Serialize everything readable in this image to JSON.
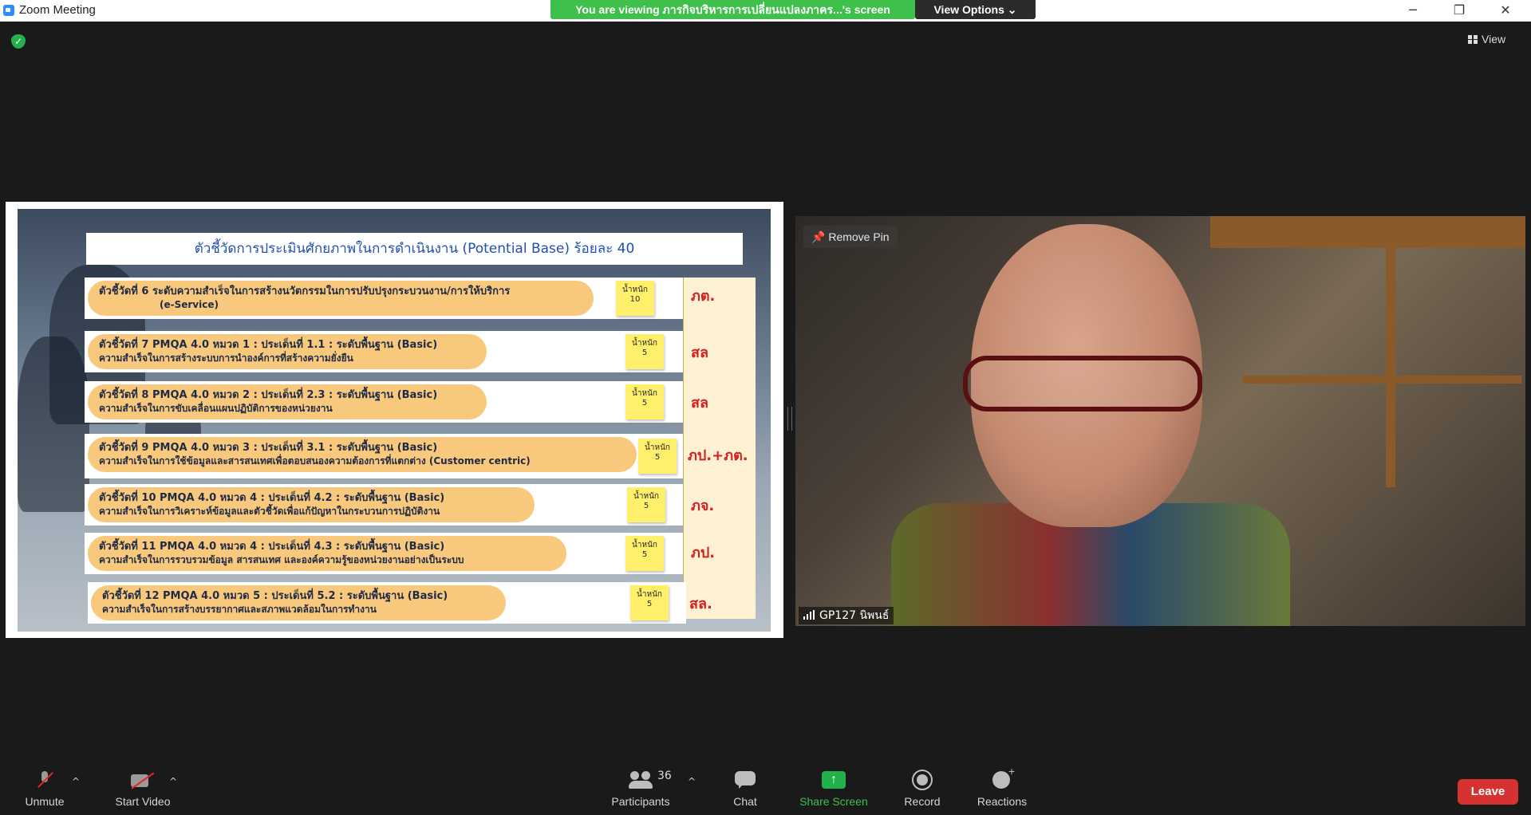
{
  "window": {
    "title": "Zoom Meeting",
    "share_banner": "You are viewing ภารกิจบริหารการเปลี่ยนแปลงภาคร...'s screen",
    "view_options": "View Options",
    "view_label": "View"
  },
  "slide": {
    "title": "ตัวชี้วัดการประเมินศักยภาพในการดำเนินงาน (Potential Base) ร้อยละ 40",
    "indicators": [
      {
        "line1": "ตัวชี้วัดที่ 6 ระดับความสำเร็จในการสร้างนวัตกรรมในการปรับปรุงกระบวนงาน/การให้บริการ",
        "line2": "(e-Service)",
        "weight_label": "น้ำหนัก",
        "weight": "10",
        "unit": "ภต."
      },
      {
        "line1": "ตัวชี้วัดที่ 7 PMQA 4.0 หมวด 1 : ประเด็นที่ 1.1 : ระดับพื้นฐาน (Basic)",
        "line2": "ความสำเร็จในการสร้างระบบการนำองค์การที่สร้างความยั่งยืน",
        "weight_label": "น้ำหนัก",
        "weight": "5",
        "unit": "สล"
      },
      {
        "line1": "ตัวชี้วัดที่ 8 PMQA 4.0 หมวด 2 : ประเด็นที่ 2.3 : ระดับพื้นฐาน (Basic)",
        "line2": "ความสำเร็จในการขับเคลื่อนแผนปฏิบัติการของหน่วยงาน",
        "weight_label": "น้ำหนัก",
        "weight": "5",
        "unit": "สล"
      },
      {
        "line1": "ตัวชี้วัดที่ 9 PMQA 4.0 หมวด 3 : ประเด็นที่ 3.1 : ระดับพื้นฐาน (Basic)",
        "line2": "ความสำเร็จในการใช้ข้อมูลและสารสนเทศเพื่อตอบสนองความต้องการที่แตกต่าง (Customer centric)",
        "weight_label": "น้ำหนัก",
        "weight": "5",
        "unit": "ภป.+ภต."
      },
      {
        "line1": "ตัวชี้วัดที่ 10 PMQA 4.0 หมวด 4 : ประเด็นที่ 4.2 : ระดับพื้นฐาน (Basic)",
        "line2": "ความสำเร็จในการวิเคราะห์ข้อมูลและตัวชี้วัดเพื่อแก้ปัญหาในกระบวนการปฏิบัติงาน",
        "weight_label": "น้ำหนัก",
        "weight": "5",
        "unit": "ภจ."
      },
      {
        "line1": "ตัวชี้วัดที่ 11 PMQA 4.0 หมวด 4 : ประเด็นที่ 4.3 : ระดับพื้นฐาน (Basic)",
        "line2": "ความสำเร็จในการรวบรวมข้อมูล สารสนเทศ และองค์ความรู้ของหน่วยงานอย่างเป็นระบบ",
        "weight_label": "น้ำหนัก",
        "weight": "5",
        "unit": "ภป."
      },
      {
        "line1": "ตัวชี้วัดที่ 12 PMQA 4.0 หมวด 5 : ประเด็นที่ 5.2 : ระดับพื้นฐาน (Basic)",
        "line2": "ความสำเร็จในการสร้างบรรยากาศและสภาพแวดล้อมในการทำงาน",
        "weight_label": "น้ำหนัก",
        "weight": "5",
        "unit": "สล."
      }
    ]
  },
  "video": {
    "remove_pin": "Remove Pin",
    "participant_name": "GP127 นิพนธ์"
  },
  "toolbar": {
    "unmute": "Unmute",
    "start_video": "Start Video",
    "participants": "Participants",
    "participant_count": "36",
    "chat": "Chat",
    "share_screen": "Share Screen",
    "record": "Record",
    "reactions": "Reactions",
    "leave": "Leave"
  }
}
